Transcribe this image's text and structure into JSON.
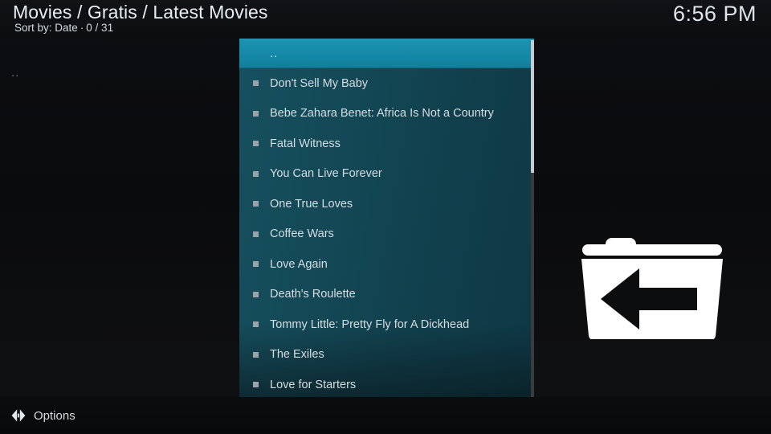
{
  "header": {
    "title": "Movies / Gratis / Latest Movies",
    "sort_label": "Sort by: Date",
    "separator": "·",
    "count": "0 / 31",
    "clock": "6:56 PM"
  },
  "sidebar": {
    "updir_label": ".."
  },
  "list": {
    "items": [
      {
        "label": "..",
        "selected": true,
        "bullet": false
      },
      {
        "label": "Don't Sell My Baby",
        "selected": false,
        "bullet": true
      },
      {
        "label": "Bebe Zahara Benet: Africa Is Not a Country",
        "selected": false,
        "bullet": true
      },
      {
        "label": "Fatal Witness",
        "selected": false,
        "bullet": true
      },
      {
        "label": "You Can Live Forever",
        "selected": false,
        "bullet": true
      },
      {
        "label": "One True Loves",
        "selected": false,
        "bullet": true
      },
      {
        "label": "Coffee Wars",
        "selected": false,
        "bullet": true
      },
      {
        "label": "Love Again",
        "selected": false,
        "bullet": true
      },
      {
        "label": "Death's Roulette",
        "selected": false,
        "bullet": true
      },
      {
        "label": "Tommy Little: Pretty Fly for A Dickhead",
        "selected": false,
        "bullet": true
      },
      {
        "label": "The Exiles",
        "selected": false,
        "bullet": true
      },
      {
        "label": "Love for Starters",
        "selected": false,
        "bullet": true
      }
    ]
  },
  "preview": {
    "icon": "folder-back-icon"
  },
  "footer": {
    "options_label": "Options",
    "options_icon": "left-right-arrows-icon"
  },
  "colors": {
    "accent": "#1689a7",
    "panel": "#144a58",
    "background": "#0d0e10",
    "text": "#d6dde1"
  }
}
